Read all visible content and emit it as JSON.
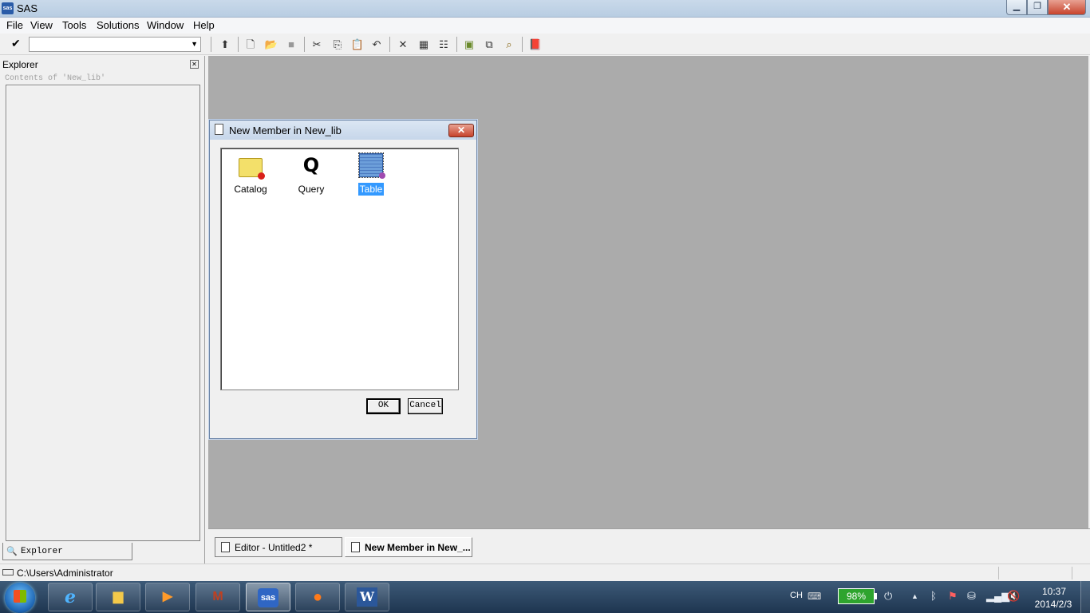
{
  "window": {
    "title": "SAS",
    "logo_text": "sas"
  },
  "menu": [
    "File",
    "View",
    "Tools",
    "Solutions",
    "Window",
    "Help"
  ],
  "toolbar": {
    "command_value": ""
  },
  "explorer": {
    "title": "Explorer",
    "contents_label": "Contents of 'New_lib'",
    "tab_label": "Explorer"
  },
  "dialog": {
    "title": "New Member in New_lib",
    "members": [
      {
        "label": "Catalog",
        "selected": false
      },
      {
        "label": "Query",
        "selected": false
      },
      {
        "label": "Table",
        "selected": true
      }
    ],
    "ok_label": "OK",
    "cancel_label": "Cancel"
  },
  "window_tabs": [
    {
      "label": "Editor - Untitled2 *",
      "active": false
    },
    {
      "label": "New Member in New_...",
      "active": true
    }
  ],
  "status": {
    "path": "C:\\Users\\Administrator"
  },
  "taskbar": {
    "tray": {
      "language": "CH",
      "battery": "98%",
      "time": "10:37",
      "date": "2014/2/3"
    }
  },
  "colors": {
    "selection": "#3399ff",
    "workspace": "#ababab",
    "close_button": "#c7432c"
  }
}
